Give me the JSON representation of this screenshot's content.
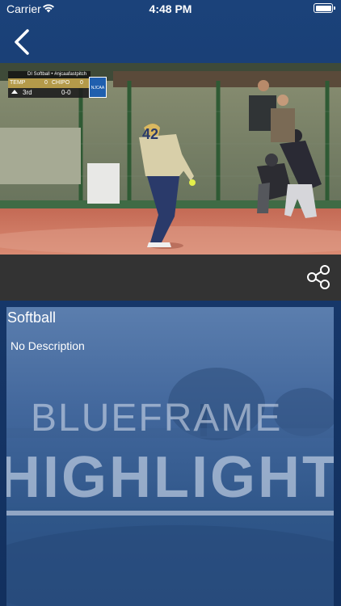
{
  "status_bar": {
    "carrier": "Carrier",
    "time": "4:48 PM"
  },
  "nav": {
    "back_icon": "chevron-left-icon"
  },
  "video": {
    "scorebug": {
      "title": "DI Softball • #njcaafastpitch",
      "team1": "TEMP",
      "score1": "0",
      "team2": "CHIPO",
      "score2": "0",
      "inning": "3rd",
      "count": "0-0",
      "logo": "NJCAA"
    },
    "jersey_number": "42"
  },
  "toolbar": {
    "share_icon": "share-icon"
  },
  "event": {
    "title": "Softball",
    "description": "No Description",
    "thumbnail_text_line1": "BLUEFRAME",
    "thumbnail_text_line2": "HIGHLIGHT"
  },
  "colors": {
    "background": "#163a6e",
    "toolbar": "#333333",
    "accent": "#ffffff"
  }
}
